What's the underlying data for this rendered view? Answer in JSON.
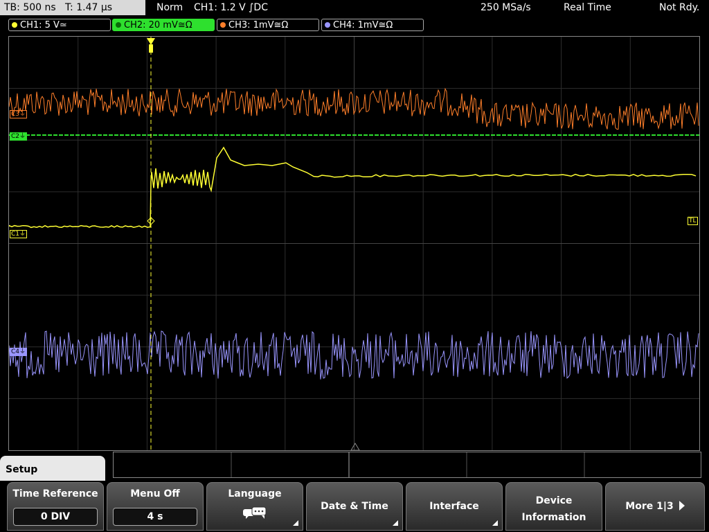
{
  "status_bar": {
    "timebase": "TB: 500 ns",
    "trigger_time": "T: 1.47 µs",
    "mode": "Norm",
    "trigger": "CH1: 1.2 V ∫DC",
    "sample_rate": "250 MSa/s",
    "acquisition": "Real Time",
    "state": "Not Rdy."
  },
  "channels": [
    {
      "label": "CH1: 5 V≃",
      "color": "#ffff33"
    },
    {
      "label": "CH2: 20 mV≅Ω",
      "color": "#2ee02e"
    },
    {
      "label": "CH3: 1mV≅Ω",
      "color": "#ff7f2a"
    },
    {
      "label": "CH4: 1mV≅Ω",
      "color": "#9a96ff"
    }
  ],
  "markers": {
    "c3": "C3⏚",
    "c2": "C2⏚",
    "c1": "C1⏚",
    "tl": "TL",
    "c4": "C4⏚"
  },
  "menu": {
    "title": "Setup",
    "softkeys": [
      {
        "label": "Time Reference",
        "value": "0 DIV"
      },
      {
        "label": "Menu Off",
        "value": "4 s"
      },
      {
        "label": "Language"
      },
      {
        "label": "Date & Time"
      },
      {
        "label": "Interface"
      },
      {
        "label_line1": "Device",
        "label_line2": "Information"
      },
      {
        "label": "More 1|3"
      }
    ]
  }
}
